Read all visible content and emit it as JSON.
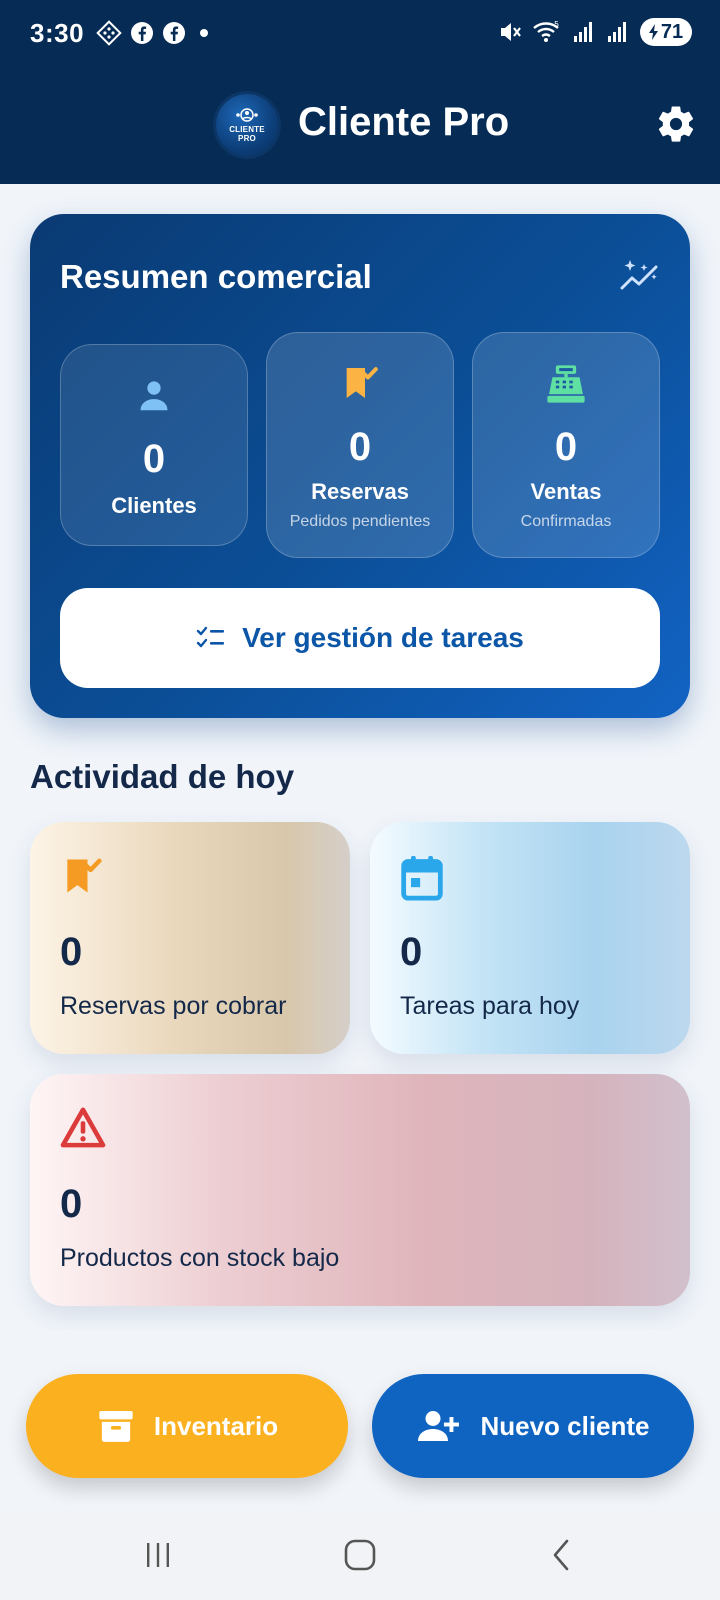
{
  "status_bar": {
    "time": "3:30",
    "battery": "71",
    "icons_left": [
      "dots-diamond-icon",
      "facebook-icon",
      "facebook-icon",
      "dot-icon"
    ],
    "icons_right": [
      "mute-icon",
      "wifi-icon",
      "signal-icon",
      "signal-icon",
      "battery-icon"
    ]
  },
  "app_bar": {
    "title": "Cliente Pro",
    "logo_text_line1": "CLIENTE",
    "logo_text_line2": "PRO",
    "settings_icon": "gear-icon"
  },
  "summary": {
    "title": "Resumen comercial",
    "stats": [
      {
        "value": "0",
        "label": "Clientes",
        "sublabel": "",
        "icon": "person-icon",
        "color": "#7fc0f5"
      },
      {
        "value": "0",
        "label": "Reservas",
        "sublabel": "Pedidos pendientes",
        "icon": "bookmark-check-icon",
        "color": "#fbb443"
      },
      {
        "value": "0",
        "label": "Ventas",
        "sublabel": "Confirmadas",
        "icon": "cash-register-icon",
        "color": "#5fe0a2"
      }
    ],
    "tasks_button": "Ver gestión de tareas"
  },
  "today": {
    "title": "Actividad de hoy",
    "cards": [
      {
        "value": "0",
        "label": "Reservas por cobrar",
        "icon": "bookmark-check-icon",
        "color": "#f59a23"
      },
      {
        "value": "0",
        "label": "Tareas para hoy",
        "icon": "calendar-icon",
        "color": "#2aa6ea"
      },
      {
        "value": "0",
        "label": "Productos con stock bajo",
        "icon": "warning-icon",
        "color": "#dc3b3b"
      }
    ]
  },
  "actions": {
    "inventory_label": "Inventario",
    "new_client_label": "Nuevo cliente"
  },
  "colors": {
    "primary_dark": "#062b55",
    "primary": "#0f63c1",
    "accent": "#fbb01f"
  }
}
